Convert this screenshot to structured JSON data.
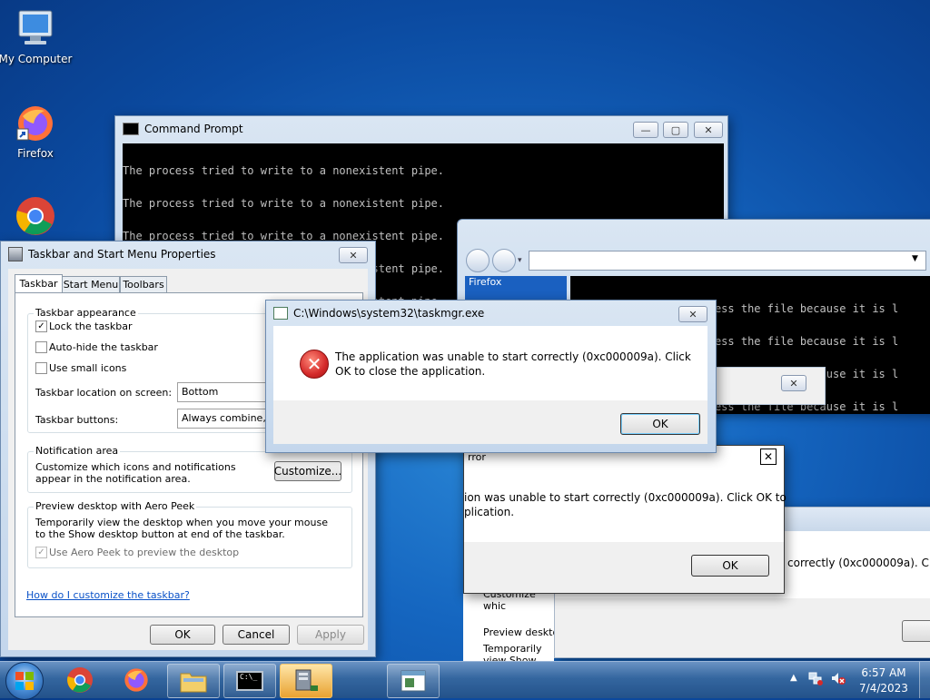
{
  "desktop": {
    "icons": [
      {
        "label": "My Computer",
        "icon": "computer-icon"
      },
      {
        "label": "Firefox",
        "icon": "firefox-icon"
      },
      {
        "label": "",
        "icon": "chrome-icon"
      }
    ]
  },
  "cmd": {
    "title": "Command Prompt",
    "line": "The process tried to write to a nonexistent pipe.",
    "lines_partial": [
      "The process tried to write to a nonexistent pi",
      "existent pi",
      "existent pi",
      "existent pi",
      "existent pi",
      "existent pi"
    ]
  },
  "browser": {
    "tab_label": "Firefox",
    "console_line": "The process cannot access the file because it is l"
  },
  "taskbar_props": {
    "title": "Taskbar and Start Menu Properties",
    "tabs": [
      "Taskbar",
      "Start Menu",
      "Toolbars"
    ],
    "appearance_group": "Taskbar appearance",
    "lock": "Lock the taskbar",
    "autohide": "Auto-hide the taskbar",
    "small_icons": "Use small icons",
    "location_label": "Taskbar location on screen:",
    "location_value": "Bottom",
    "buttons_label": "Taskbar buttons:",
    "buttons_value": "Always combine, hide labels",
    "notif_group": "Notification area",
    "notif_text": "Customize which icons and notifications appear in the notification area.",
    "customize": "Customize...",
    "peek_group": "Preview desktop with Aero Peek",
    "peek_text": "Temporarily view the desktop when you move your mouse to the Show desktop button at end of the taskbar.",
    "peek_check": "Use Aero Peek to preview the desktop",
    "help_link": "How do I customize the taskbar?",
    "ok": "OK",
    "cancel": "Cancel",
    "apply": "Apply"
  },
  "error_main": {
    "title": "C:\\Windows\\system32\\taskmgr.exe",
    "message": "The application was unable to start correctly (0xc000009a). Click OK to close the application.",
    "ok": "OK"
  },
  "error_second": {
    "title_frag": "rror",
    "line1": "ion was unable to start correctly (0xc000009a). Click OK to",
    "line2": "plication.",
    "ok": "OK"
  },
  "error_third": {
    "line": "correctly (0xc000009a). Click O"
  },
  "bg_props": {
    "notif_text_frag": "Customize whic notification area",
    "peek_frag": "Preview desktop",
    "peek_text_frag": "Temporarily view Show desktop b"
  },
  "tray": {
    "time": "6:57 AM",
    "date": "7/4/2023"
  },
  "colors": {
    "accent": "#1e3287",
    "error_red": "#d42a2a",
    "link": "#0a52c8"
  }
}
